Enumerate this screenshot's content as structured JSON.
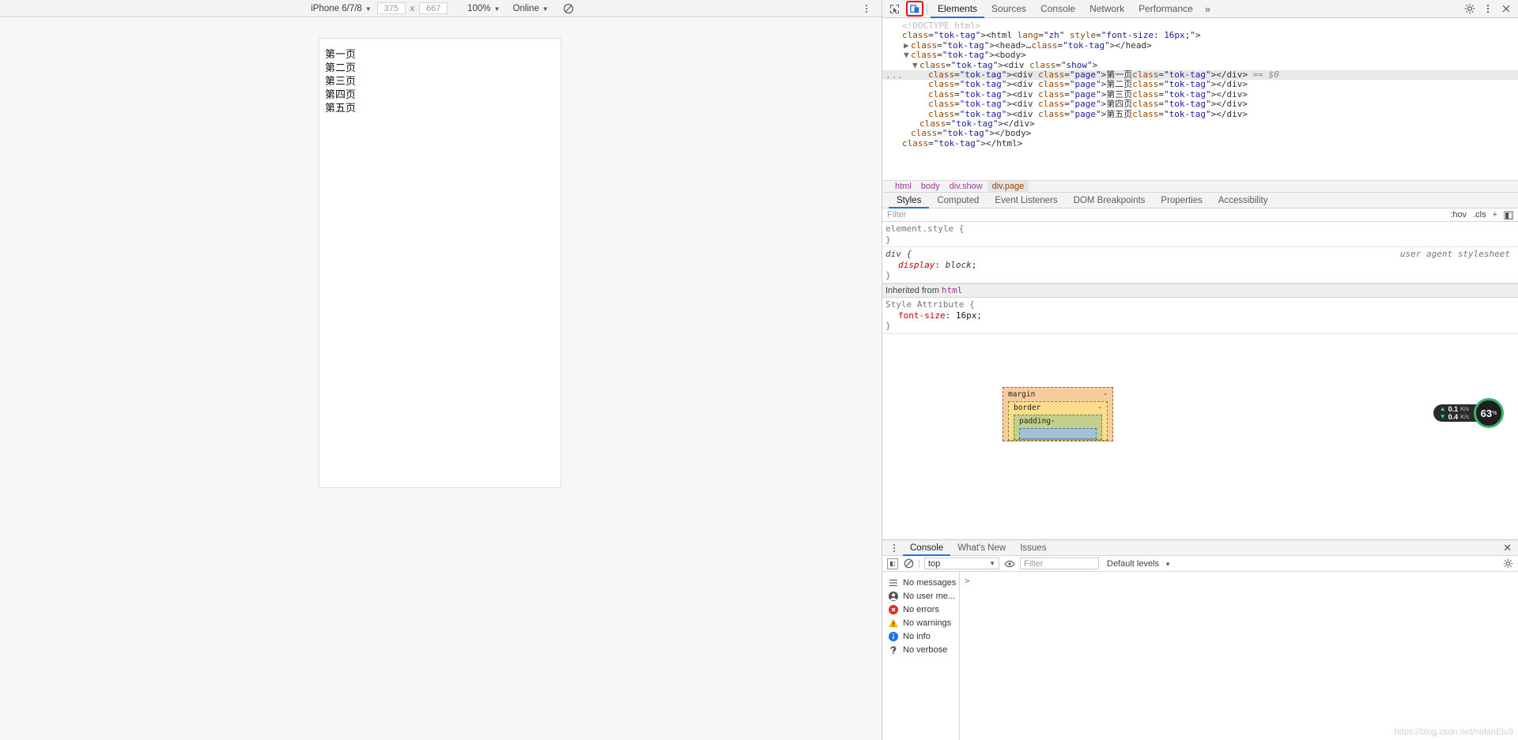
{
  "device_toolbar": {
    "device_name": "iPhone 6/7/8",
    "width": "375",
    "x_separator": "x",
    "height": "667",
    "zoom": "100%",
    "throttling": "Online",
    "rotate_icon": "rotate-icon",
    "more_icon": "more-vertical-icon"
  },
  "viewport": {
    "pages": [
      "第一页",
      "第二页",
      "第三页",
      "第四页",
      "第五页"
    ]
  },
  "devtools": {
    "inspect_icon": "inspect-element-icon",
    "device_toggle_icon": "toggle-device-toolbar-icon",
    "tabs": [
      {
        "label": "Elements",
        "active": true
      },
      {
        "label": "Sources",
        "active": false
      },
      {
        "label": "Console",
        "active": false
      },
      {
        "label": "Network",
        "active": false
      },
      {
        "label": "Performance",
        "active": false
      }
    ],
    "more_tabs_label": "»",
    "settings_icon": "gear-icon",
    "dock_icon": "more-vertical-icon",
    "close_icon": "close-icon"
  },
  "dom_tree": {
    "lines": [
      {
        "indent": 0,
        "arrow": "",
        "text": "<!DOCTYPE html>",
        "kind": "doctype"
      },
      {
        "indent": 0,
        "arrow": "",
        "text": "<html lang=\"zh\" style=\"font-size: 16px;\">",
        "kind": "tag"
      },
      {
        "indent": 1,
        "arrow": "▶",
        "text": "<head>…</head>",
        "kind": "tag"
      },
      {
        "indent": 1,
        "arrow": "▼",
        "text": "<body>",
        "kind": "tag"
      },
      {
        "indent": 2,
        "arrow": "▼",
        "text": "<div class=\"show\">",
        "kind": "tag"
      },
      {
        "indent": 3,
        "arrow": "",
        "text": "<div class=\"page\">第一页</div>",
        "kind": "tag",
        "selected": true,
        "suffix": "== $0",
        "badge": "..."
      },
      {
        "indent": 3,
        "arrow": "",
        "text": "<div class=\"page\">第二页</div>",
        "kind": "tag"
      },
      {
        "indent": 3,
        "arrow": "",
        "text": "<div class=\"page\">第三页</div>",
        "kind": "tag"
      },
      {
        "indent": 3,
        "arrow": "",
        "text": "<div class=\"page\">第四页</div>",
        "kind": "tag"
      },
      {
        "indent": 3,
        "arrow": "",
        "text": "<div class=\"page\">第五页</div>",
        "kind": "tag"
      },
      {
        "indent": 2,
        "arrow": "",
        "text": "</div>",
        "kind": "tag"
      },
      {
        "indent": 1,
        "arrow": "",
        "text": "</body>",
        "kind": "tag"
      },
      {
        "indent": 0,
        "arrow": "",
        "text": "</html>",
        "kind": "tag"
      }
    ]
  },
  "breadcrumb": [
    "html",
    "body",
    "div.show",
    "div.page"
  ],
  "styles_panel": {
    "tabs": [
      {
        "label": "Styles",
        "active": true
      },
      {
        "label": "Computed",
        "active": false
      },
      {
        "label": "Event Listeners",
        "active": false
      },
      {
        "label": "DOM Breakpoints",
        "active": false
      },
      {
        "label": "Properties",
        "active": false
      },
      {
        "label": "Accessibility",
        "active": false
      }
    ],
    "filter_placeholder": "Filter",
    "hov_label": ":hov",
    "cls_label": ".cls",
    "plus_label": "+",
    "rules": [
      {
        "selector": "element.style {",
        "close": "}",
        "props": [],
        "origin": ""
      },
      {
        "selector": "div {",
        "close": "}",
        "origin": "user agent stylesheet",
        "props": [
          {
            "name": "display",
            "value": "block"
          }
        ],
        "ua": true
      },
      {
        "inherited_label": "Inherited from",
        "inherited_tag": "html"
      },
      {
        "selector": "Style Attribute {",
        "close": "}",
        "origin": "",
        "props": [
          {
            "name": "font-size",
            "value": "16px"
          }
        ]
      }
    ]
  },
  "box_model": {
    "margin_label": "margin",
    "margin_value": "-",
    "border_label": "border",
    "border_value": "-",
    "padding_label": "padding-"
  },
  "network_badge": {
    "upload": "0.1",
    "upload_unit": "K/s",
    "download": "0.4",
    "download_unit": "K/s",
    "percent": "63",
    "percent_unit": "%"
  },
  "drawer": {
    "tabs": [
      {
        "label": "Console",
        "active": true
      },
      {
        "label": "What's New",
        "active": false
      },
      {
        "label": "Issues",
        "active": false
      }
    ],
    "close_icon": "close-icon",
    "toolbar": {
      "sidebar_icon": "show-console-sidebar-icon",
      "clear_icon": "clear-console-icon",
      "context": "top",
      "eye_icon": "eye-icon",
      "filter_placeholder": "Filter",
      "levels": "Default levels",
      "settings_icon": "gear-icon"
    },
    "sidebar": [
      {
        "icon": "list-icon",
        "label": "No messages"
      },
      {
        "icon": "user-icon",
        "label": "No user me..."
      },
      {
        "icon": "error-icon",
        "label": "No errors"
      },
      {
        "icon": "warning-icon",
        "label": "No warnings"
      },
      {
        "icon": "info-icon",
        "label": "No info"
      },
      {
        "icon": "verbose-icon",
        "label": "No verbose"
      }
    ],
    "prompt": ">"
  },
  "watermark": "https://blog.csdn.net/nolanElu9",
  "colors": {
    "accent": "#1a73e8",
    "highlight": "#e81313",
    "tag": "#881280",
    "attr": "#994500",
    "value": "#1a1aa6"
  }
}
